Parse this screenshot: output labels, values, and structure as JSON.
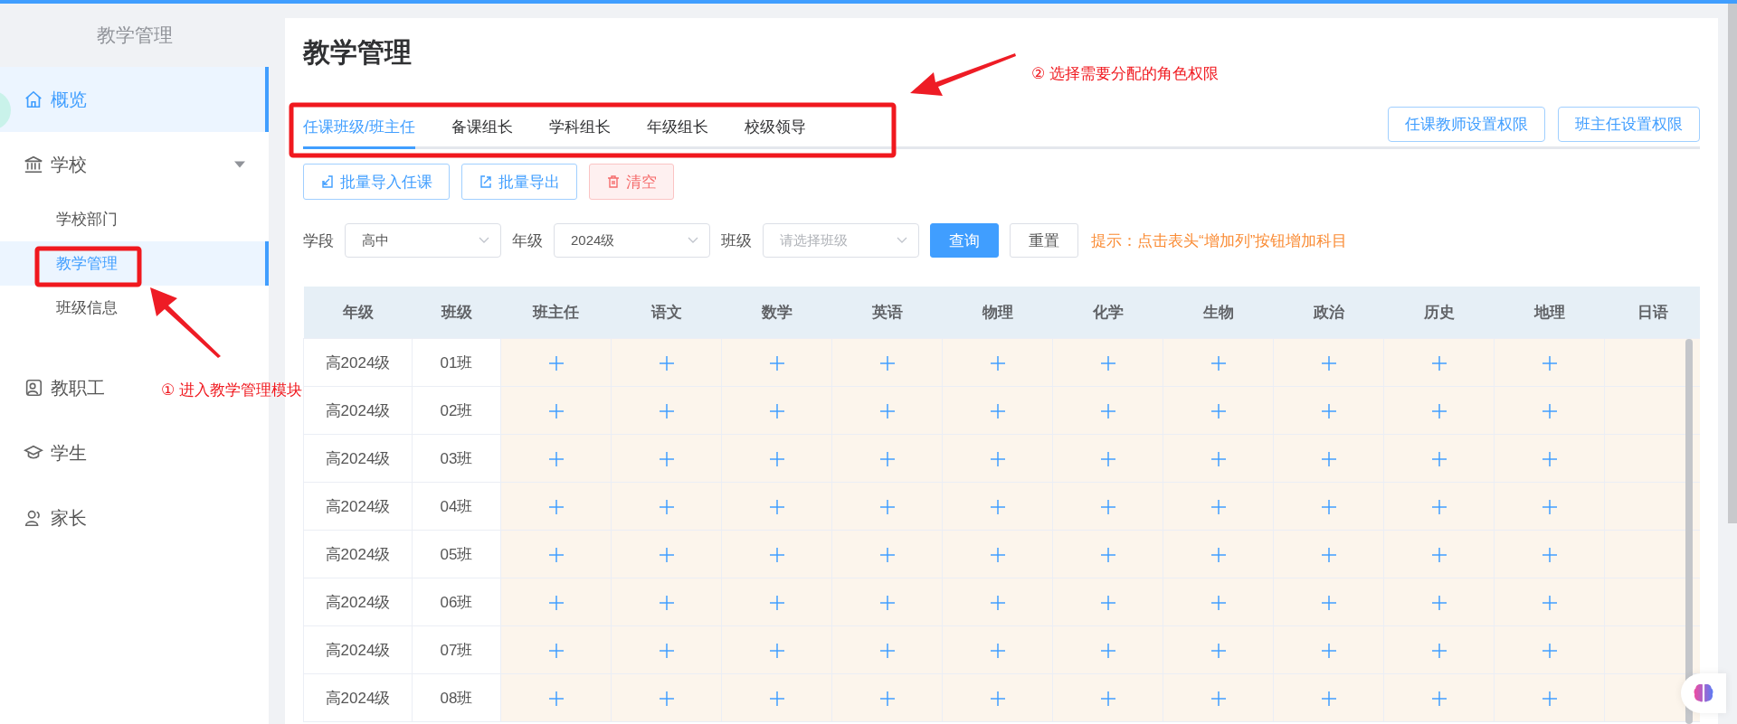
{
  "sidebar": {
    "title": "教学管理",
    "items": [
      {
        "kind": "item",
        "label": "概览",
        "selected": true
      },
      {
        "kind": "group",
        "label": "学校",
        "selected": false,
        "expanded": true,
        "children": [
          {
            "label": "学校部门",
            "selected": false
          },
          {
            "label": "教学管理",
            "selected": true
          },
          {
            "label": "班级信息",
            "selected": false
          }
        ]
      },
      {
        "kind": "item",
        "label": "教职工",
        "selected": false
      },
      {
        "kind": "item",
        "label": "学生",
        "selected": false
      },
      {
        "kind": "item",
        "label": "家长",
        "selected": false
      }
    ]
  },
  "page_title": "教学管理",
  "tabs": [
    {
      "label": "任课班级/班主任",
      "selected": true
    },
    {
      "label": "备课组长",
      "selected": false
    },
    {
      "label": "学科组长",
      "selected": false
    },
    {
      "label": "年级组长",
      "selected": false
    },
    {
      "label": "校级领导",
      "selected": false
    }
  ],
  "permission_buttons": [
    "任课教师设置权限",
    "班主任设置权限"
  ],
  "action_buttons": [
    {
      "kind": "import",
      "label": "批量导入任课"
    },
    {
      "kind": "export",
      "label": "批量导出"
    },
    {
      "kind": "danger",
      "label": "清空"
    }
  ],
  "filters": [
    {
      "label": "学段",
      "value": "高中"
    },
    {
      "label": "年级",
      "value": "2024级"
    },
    {
      "label": "班级",
      "placeholder": "请选择班级"
    }
  ],
  "query_buttons": [
    {
      "kind": "primary",
      "label": "查询"
    },
    {
      "kind": "default",
      "label": "重置"
    }
  ],
  "hint": "提示：点击表头“增加列”按钮增加科目",
  "table": {
    "columns": [
      "年级",
      "班级",
      "班主任",
      "语文",
      "数学",
      "英语",
      "物理",
      "化学",
      "生物",
      "政治",
      "历史",
      "地理",
      "日语"
    ],
    "rows": [
      {
        "grade": "高2024级",
        "class": "01班"
      },
      {
        "grade": "高2024级",
        "class": "02班"
      },
      {
        "grade": "高2024级",
        "class": "03班"
      },
      {
        "grade": "高2024级",
        "class": "04班"
      },
      {
        "grade": "高2024级",
        "class": "05班"
      },
      {
        "grade": "高2024级",
        "class": "06班"
      },
      {
        "grade": "高2024级",
        "class": "07班"
      },
      {
        "grade": "高2024级",
        "class": "08班"
      }
    ]
  },
  "annotations": [
    {
      "text": "① 进入教学管理模块"
    },
    {
      "text": "② 选择需要分配的角色权限"
    }
  ]
}
